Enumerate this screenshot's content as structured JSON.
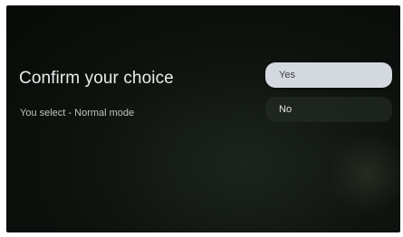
{
  "dialog": {
    "title": "Confirm your choice",
    "subtitle": "You select - Normal mode"
  },
  "options": [
    {
      "label": "Yes",
      "selected": true
    },
    {
      "label": "No",
      "selected": false
    }
  ],
  "colors": {
    "background": "#0f140f",
    "selected_option_bg": "#d4d9df",
    "selected_option_text": "#3a3f44",
    "unselected_option_bg": "#283028",
    "title_text": "#e9ece9"
  }
}
